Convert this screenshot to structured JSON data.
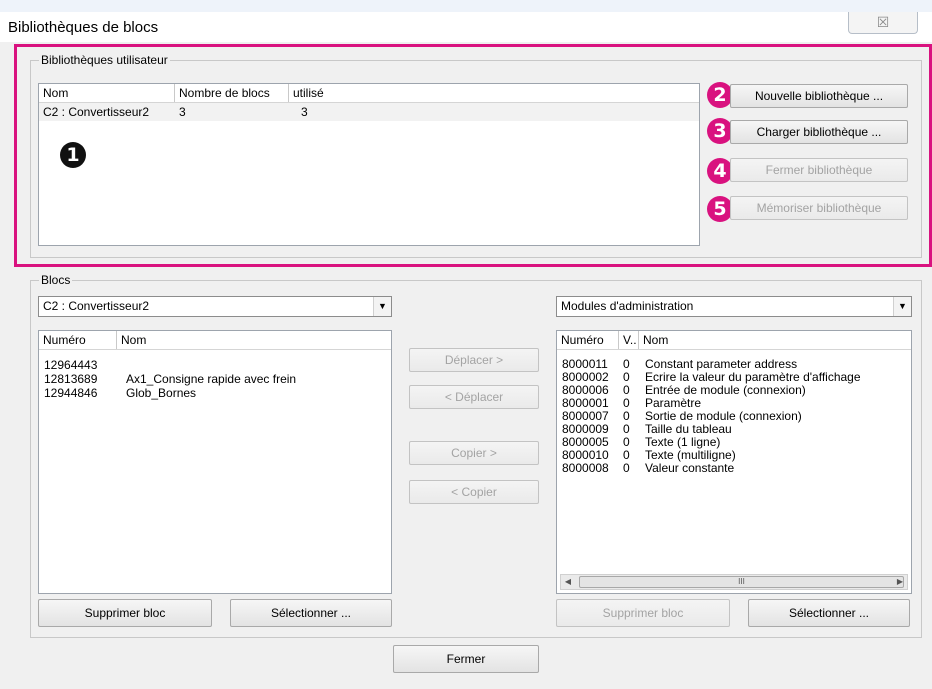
{
  "window": {
    "title": "Bibliothèques de blocs",
    "close_glyph": "☒"
  },
  "user_libraries": {
    "legend": "Bibliothèques utilisateur",
    "columns": [
      "Nom",
      "Nombre de blocs",
      "utilisé"
    ],
    "rows": [
      {
        "name": "C2 : Convertisseur2",
        "count": "3",
        "used": "3"
      }
    ],
    "buttons": {
      "new": "Nouvelle bibliothèque ...",
      "load": "Charger bibliothèque ...",
      "close": "Fermer bibliothèque",
      "save": "Mémoriser bibliothèque"
    },
    "badges": [
      "1",
      "2",
      "3",
      "4",
      "5"
    ],
    "highlight_color": "#d9127f"
  },
  "blocks": {
    "legend": "Blocs",
    "left": {
      "combo_value": "C2 : Convertisseur2",
      "columns": [
        "Numéro",
        "Nom"
      ],
      "rows": [
        {
          "num": "12964443",
          "name": ""
        },
        {
          "num": "12813689",
          "name": "Ax1_Consigne rapide avec frein"
        },
        {
          "num": "12944846",
          "name": "Glob_Bornes"
        }
      ],
      "buttons": {
        "delete": "Supprimer bloc",
        "select": "Sélectionner ..."
      }
    },
    "middle": {
      "move_right": "Déplacer >",
      "move_left": "< Déplacer",
      "copy_right": "Copier >",
      "copy_left": "< Copier"
    },
    "right": {
      "combo_value": "Modules d'administration",
      "columns": [
        "Numéro",
        "V..",
        "Nom"
      ],
      "rows": [
        {
          "num": "8000011",
          "v": "0",
          "name": "Constant parameter address"
        },
        {
          "num": "8000002",
          "v": "0",
          "name": "Ecrire la valeur du paramètre d'affichage"
        },
        {
          "num": "8000006",
          "v": "0",
          "name": "Entrée de module (connexion)"
        },
        {
          "num": "8000001",
          "v": "0",
          "name": "Paramètre"
        },
        {
          "num": "8000007",
          "v": "0",
          "name": "Sortie de module (connexion)"
        },
        {
          "num": "8000009",
          "v": "0",
          "name": "Taille du tableau"
        },
        {
          "num": "8000005",
          "v": "0",
          "name": "Texte (1 ligne)"
        },
        {
          "num": "8000010",
          "v": "0",
          "name": "Texte (multiligne)"
        },
        {
          "num": "8000008",
          "v": "0",
          "name": "Valeur constante"
        }
      ],
      "scroll_thumb_glyph": "III",
      "buttons": {
        "delete": "Supprimer bloc",
        "select": "Sélectionner ..."
      }
    }
  },
  "footer": {
    "close": "Fermer"
  }
}
